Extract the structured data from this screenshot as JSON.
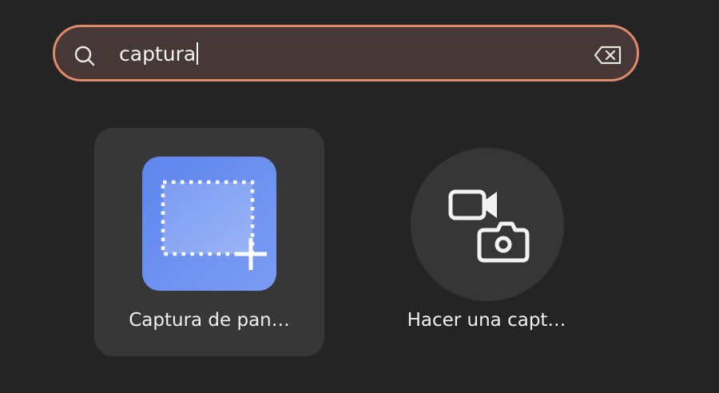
{
  "search": {
    "value": "captura"
  },
  "results": [
    {
      "label": "Captura de pan…",
      "icon": "screenshot-app-icon",
      "selected": true
    },
    {
      "label": "Hacer una capt…",
      "icon": "screencast-camera-icon",
      "selected": false
    }
  ],
  "colors": {
    "background": "#242424",
    "search_border": "#e08a6a",
    "search_fill": "#463836",
    "selected_tile": "#373737",
    "icon_blue": "#6b8ef0"
  }
}
